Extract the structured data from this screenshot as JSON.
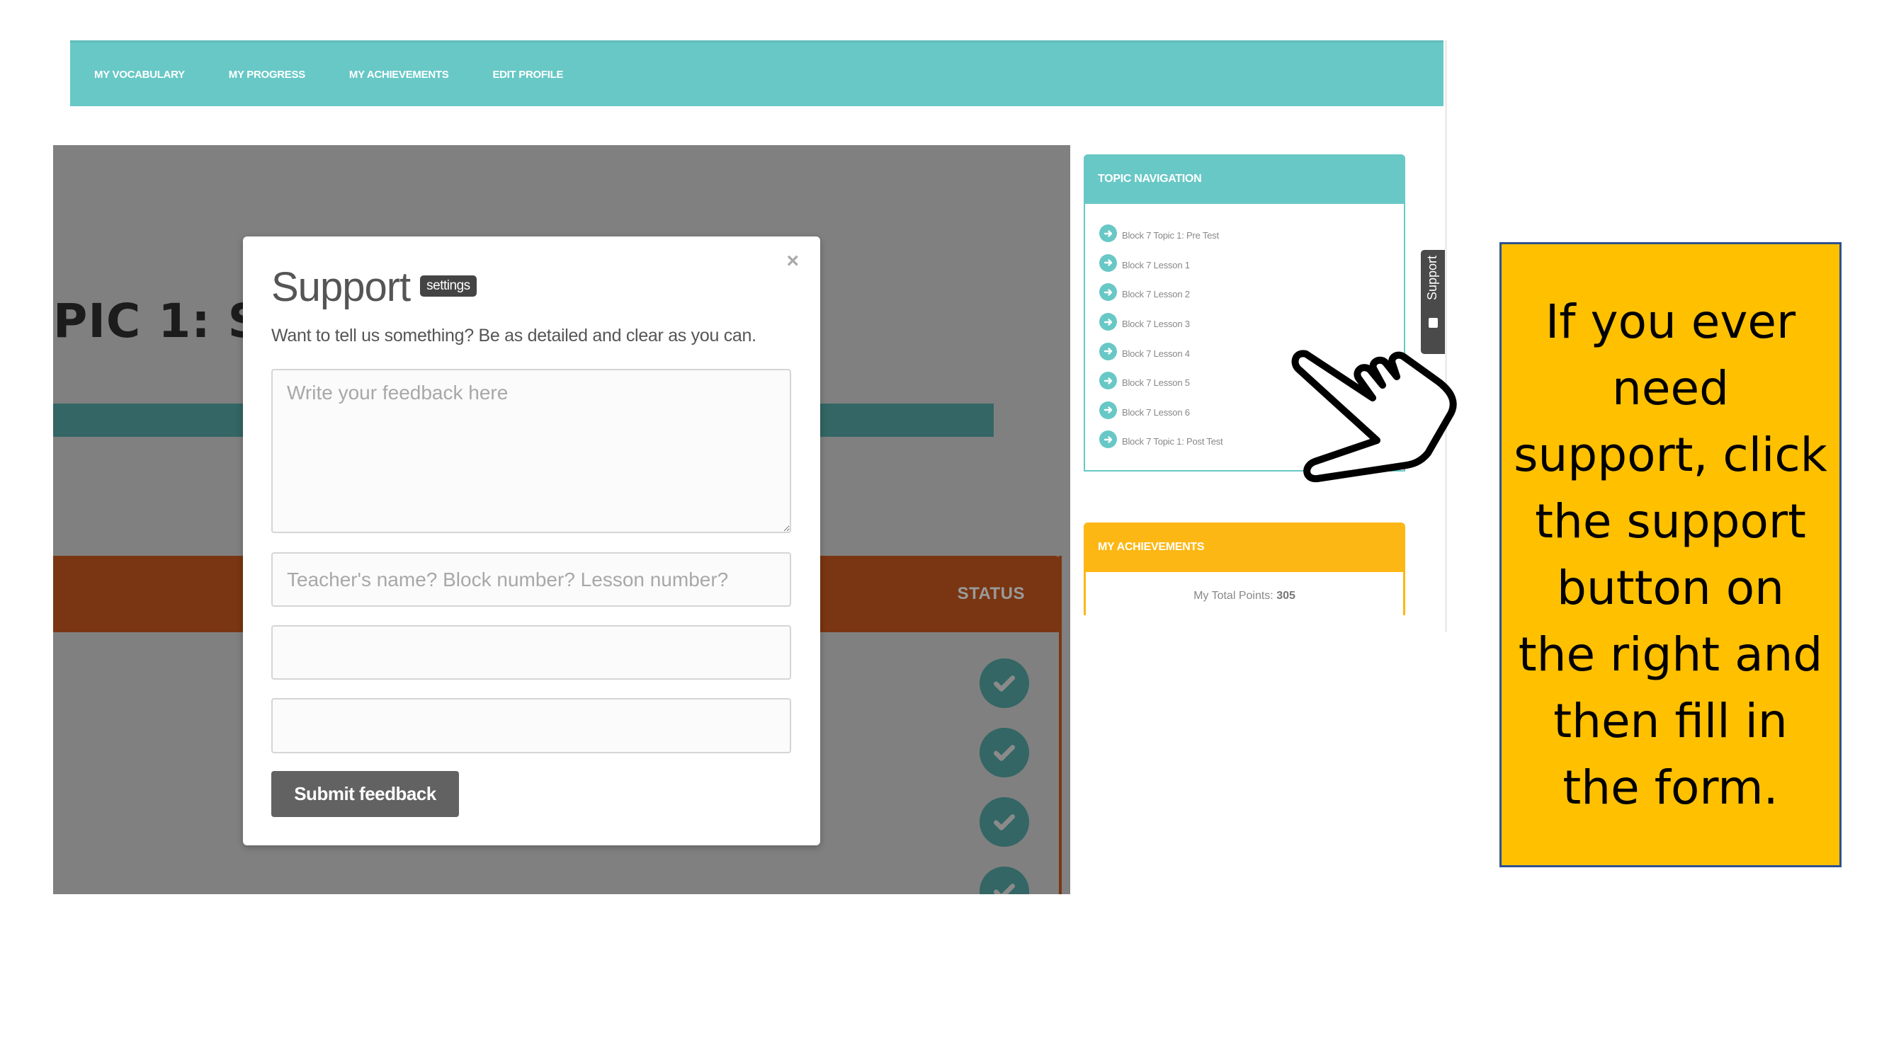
{
  "topnav": {
    "items": [
      {
        "label": "MY VOCABULARY"
      },
      {
        "label": "MY PROGRESS"
      },
      {
        "label": "MY ACHIEVEMENTS"
      },
      {
        "label": "EDIT PROFILE"
      }
    ]
  },
  "background": {
    "title_fragment": "PIC 1: ST",
    "table_status_header": "STATUS",
    "status_icons": [
      "check-circle",
      "check-circle",
      "check-circle",
      "check-circle",
      "check-circle"
    ]
  },
  "modal": {
    "title": "Support",
    "badge": "settings",
    "subtitle": "Want to tell us something? Be as detailed and clear as you can.",
    "close_label": "×",
    "feedback_placeholder": "Write your feedback here",
    "feedback_value": "",
    "details_placeholder": "Teacher's name? Block number? Lesson number?",
    "details_value": "",
    "field2_value": "",
    "field3_value": "",
    "submit_label": "Submit feedback"
  },
  "topic_navigation": {
    "title": "TOPIC NAVIGATION",
    "items": [
      {
        "label": "Block 7 Topic 1: Pre Test"
      },
      {
        "label": "Block 7 Lesson 1"
      },
      {
        "label": "Block 7 Lesson 2"
      },
      {
        "label": "Block 7 Lesson 3"
      },
      {
        "label": "Block 7 Lesson 4"
      },
      {
        "label": "Block 7 Lesson 5"
      },
      {
        "label": "Block 7 Lesson 6"
      },
      {
        "label": "Block 7 Topic 1: Post Test"
      }
    ]
  },
  "achievements": {
    "title": "MY ACHIEVEMENTS",
    "points_label": "My Total Points:",
    "points_value": "305"
  },
  "support_tab": {
    "label": "Support"
  },
  "callout": {
    "text": "If you ever need support, click the support button on the right and then fill in the form."
  },
  "colors": {
    "nav_teal": "#68c8c6",
    "dark_teal": "#336664",
    "brown": "#7a3612",
    "achievements_yellow": "#fdb714",
    "callout_yellow": "#ffc000",
    "callout_border": "#2f528f",
    "overlay_gray": "#808080"
  }
}
